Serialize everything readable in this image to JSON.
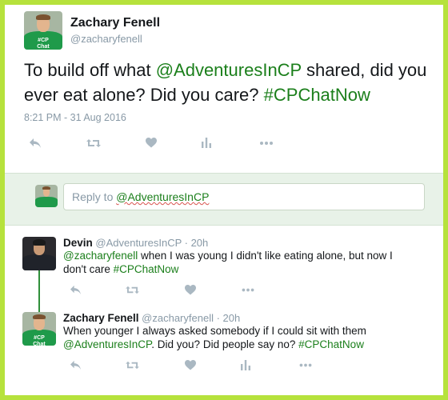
{
  "main": {
    "name": "Zachary Fenell",
    "handle": "@zacharyfenell",
    "text_pre": "To build off what ",
    "text_mention": "@AdventuresInCP",
    "text_mid": " shared, did you ever eat alone? Did you care? ",
    "text_hashtag": "#CPChatNow",
    "timestamp": "8:21 PM - 31 Aug 2016",
    "avatar_text": "#CP Chat"
  },
  "reply_box": {
    "placeholder_prefix": "Reply to ",
    "mention": "@AdventuresInCP"
  },
  "replies": [
    {
      "name": "Devin",
      "handle": "@AdventuresInCP",
      "time": "· 20h",
      "text_mention": "@zacharyfenell",
      "text_body": " when I was young I didn't like eating alone, but now I don't care ",
      "text_hashtag": "#CPChatNow"
    },
    {
      "name": "Zachary Fenell",
      "handle": "@zacharyfenell",
      "time": "· 20h",
      "text_pre": "When younger I always asked somebody if I could sit with them ",
      "text_mention": "@AdventuresInCP",
      "text_body": ". Did you? Did people say no? ",
      "text_hashtag": "#CPChatNow",
      "avatar_text": "#CP Chat"
    }
  ],
  "icons": {
    "reply": "reply-icon",
    "retweet": "retweet-icon",
    "like": "heart-icon",
    "analytics": "analytics-icon",
    "more": "more-icon"
  },
  "colors": {
    "border": "#b6e23c",
    "link": "#1b7f1b",
    "muted": "#8899a6",
    "icon": "#aab8c2",
    "reply_bg": "#e8f2e8",
    "thread_line": "#2f8f3a"
  }
}
